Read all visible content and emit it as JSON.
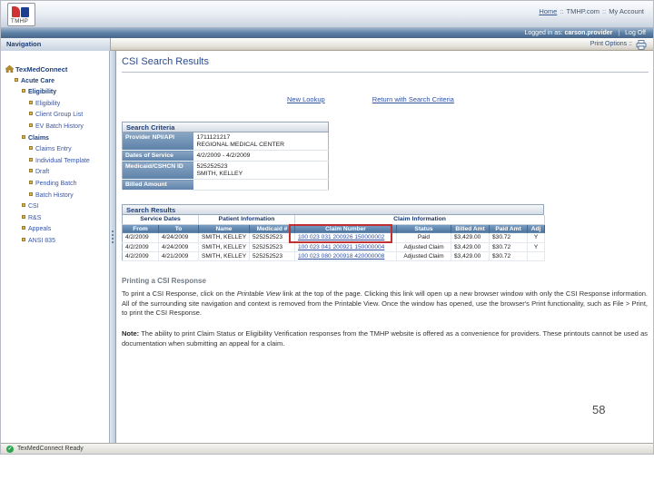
{
  "header": {
    "logo": "TMHP",
    "nav": {
      "home": "Home",
      "sep1": "::",
      "site": "TMHP.com",
      "sep2": "::",
      "account": "My Account"
    },
    "user_bar": {
      "prefix": "Logged in as:",
      "user": "carson.provider",
      "divider": "|",
      "log_off": "Log Off"
    }
  },
  "tab_strip": {
    "navigation_label": "Navigation",
    "print_options_label": "Print Options ::"
  },
  "sidebar": {
    "root": "TexMedConnect",
    "items": [
      {
        "label": "Acute Care"
      },
      {
        "label": "Eligibility"
      },
      {
        "label": "Eligibility"
      },
      {
        "label": "Client Group List"
      },
      {
        "label": "EV Batch History"
      },
      {
        "label": "Claims"
      },
      {
        "label": "Claims Entry"
      },
      {
        "label": "Individual Template"
      },
      {
        "label": "Draft"
      },
      {
        "label": "Pending Batch"
      },
      {
        "label": "Batch History"
      },
      {
        "label": "CSI"
      },
      {
        "label": "R&S"
      },
      {
        "label": "Appeals"
      },
      {
        "label": "ANSI 835"
      }
    ]
  },
  "main": {
    "title": "CSI Search Results",
    "links": {
      "new_lookup": "New Lookup",
      "return_with_criteria": "Return with Search Criteria"
    },
    "criteria": {
      "title": "Search Criteria",
      "rows": [
        {
          "label": "Provider NPI/API",
          "value": "1711121217",
          "value2": "REGIONAL MEDICAL CENTER"
        },
        {
          "label": "Dates of Service",
          "value": "4/2/2009 - 4/2/2009",
          "value2": ""
        },
        {
          "label": "Medicaid/CSHCN ID",
          "value": "525252523",
          "value2": "SMITH, KELLEY"
        },
        {
          "label": "Billed Amount",
          "value": "",
          "value2": ""
        }
      ]
    },
    "results": {
      "title": "Search Results",
      "groups": [
        "Service Dates",
        "Patient Information",
        "Claim Information"
      ],
      "columns": [
        "From",
        "To",
        "Name",
        "Medicaid #",
        "Claim Number",
        "Status",
        "Billed Amt",
        "Paid Amt",
        "Adj"
      ],
      "rows": [
        {
          "from": "4/2/2009",
          "to": "4/24/2009",
          "name": "SMITH, KELLEY",
          "medicaid": "525252523",
          "claim": "100 023 031 200926 150000002",
          "status": "Paid",
          "billed": "$3,429.00",
          "paid": "$30.72",
          "adj": "Y"
        },
        {
          "from": "4/2/2009",
          "to": "4/24/2009",
          "name": "SMITH, KELLEY",
          "medicaid": "525252523",
          "claim": "100 023 041 200921 150000004",
          "status": "Adjusted Claim",
          "billed": "$3,429.00",
          "paid": "$30.72",
          "adj": "Y"
        },
        {
          "from": "4/2/2009",
          "to": "4/21/2009",
          "name": "SMITH, KELLEY",
          "medicaid": "525252523",
          "claim": "100 023 080 200918 420000008",
          "status": "Adjusted Claim",
          "billed": "$3,429.00",
          "paid": "$30.72",
          "adj": ""
        }
      ]
    },
    "printing": {
      "heading": "Printing a CSI Response",
      "p1_before": "To print a CSI Response, click on the ",
      "p1_italic": "Printable View",
      "p1_after": " link at the top of the page. Clicking this link will open up a new browser window with only the CSI Response information. All of the surrounding site navigation and context is removed from the Printable View. Once the window has opened, use the browser's Print functionality, such as File > Print, to print the CSI Response.",
      "note_label": "Note:",
      "note_text": " The ability to print Claim Status or Eligibility Verification responses from the TMHP website is offered as a convenience for providers. These printouts cannot be used as documentation when submitting an appeal for a claim."
    },
    "page_number": "58"
  },
  "status_bar": {
    "text": "TexMedConnect Ready"
  },
  "colors": {
    "header_blue": "#5d82a9",
    "navy": "#1f3f77",
    "link_blue": "#2f4f9f",
    "highlight_red": "#c03030",
    "status_green": "#2ea44f"
  }
}
